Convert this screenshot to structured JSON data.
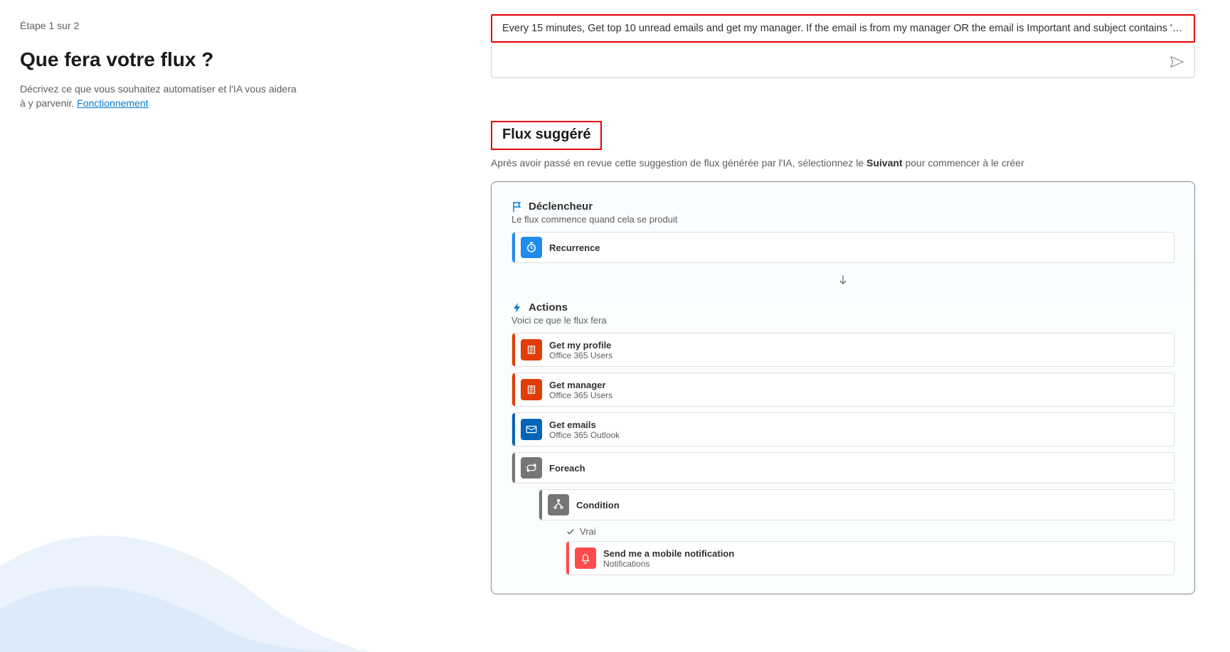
{
  "step_label": "Étape 1 sur 2",
  "main_heading": "Que fera votre flux ?",
  "description": "Décrivez ce que vous souhaitez automatiser et l'IA vous aidera à y parvenir. ",
  "link_text": "Fonctionnement",
  "prompt_text": "Every 15 minutes, Get top 10 unread emails and get my manager. If the email is from my manager OR the email is Important and subject contains 'mee...",
  "suggested_title": "Flux suggéré",
  "review_text_prefix": "Après avoir passé en revue cette suggestion de flux générée par l'IA, sélectionnez le ",
  "review_text_bold": "Suivant",
  "review_text_suffix": " pour commencer à le créer",
  "trigger": {
    "header": "Déclencheur",
    "sub": "Le flux commence quand cela se produit",
    "step": {
      "title": "Recurrence",
      "color": "#1f8bef",
      "accent": "#1f8bef",
      "icon": "clock"
    }
  },
  "actions": {
    "header": "Actions",
    "sub": "Voici ce que le flux fera",
    "items": [
      {
        "title": "Get my profile",
        "sub": "Office 365 Users",
        "color": "#e23c05",
        "accent": "#e23c05",
        "icon": "office"
      },
      {
        "title": "Get manager",
        "sub": "Office 365 Users",
        "color": "#e23c05",
        "accent": "#e23c05",
        "icon": "office"
      },
      {
        "title": "Get emails",
        "sub": "Office 365 Outlook",
        "color": "#0364b8",
        "accent": "#0364b8",
        "icon": "outlook"
      },
      {
        "title": "Foreach",
        "sub": "",
        "color": "#767676",
        "accent": "#767676",
        "icon": "loop",
        "tall": false
      },
      {
        "title": "Condition",
        "sub": "",
        "color": "#767676",
        "accent": "#767676",
        "icon": "branch",
        "nest": 1
      },
      {
        "title": "Send me a mobile notification",
        "sub": "Notifications",
        "color": "#ff4b4b",
        "accent": "#ff4b4b",
        "icon": "bell",
        "nest": 2,
        "showVrai": true
      }
    ],
    "vrai_label": "Vrai"
  }
}
